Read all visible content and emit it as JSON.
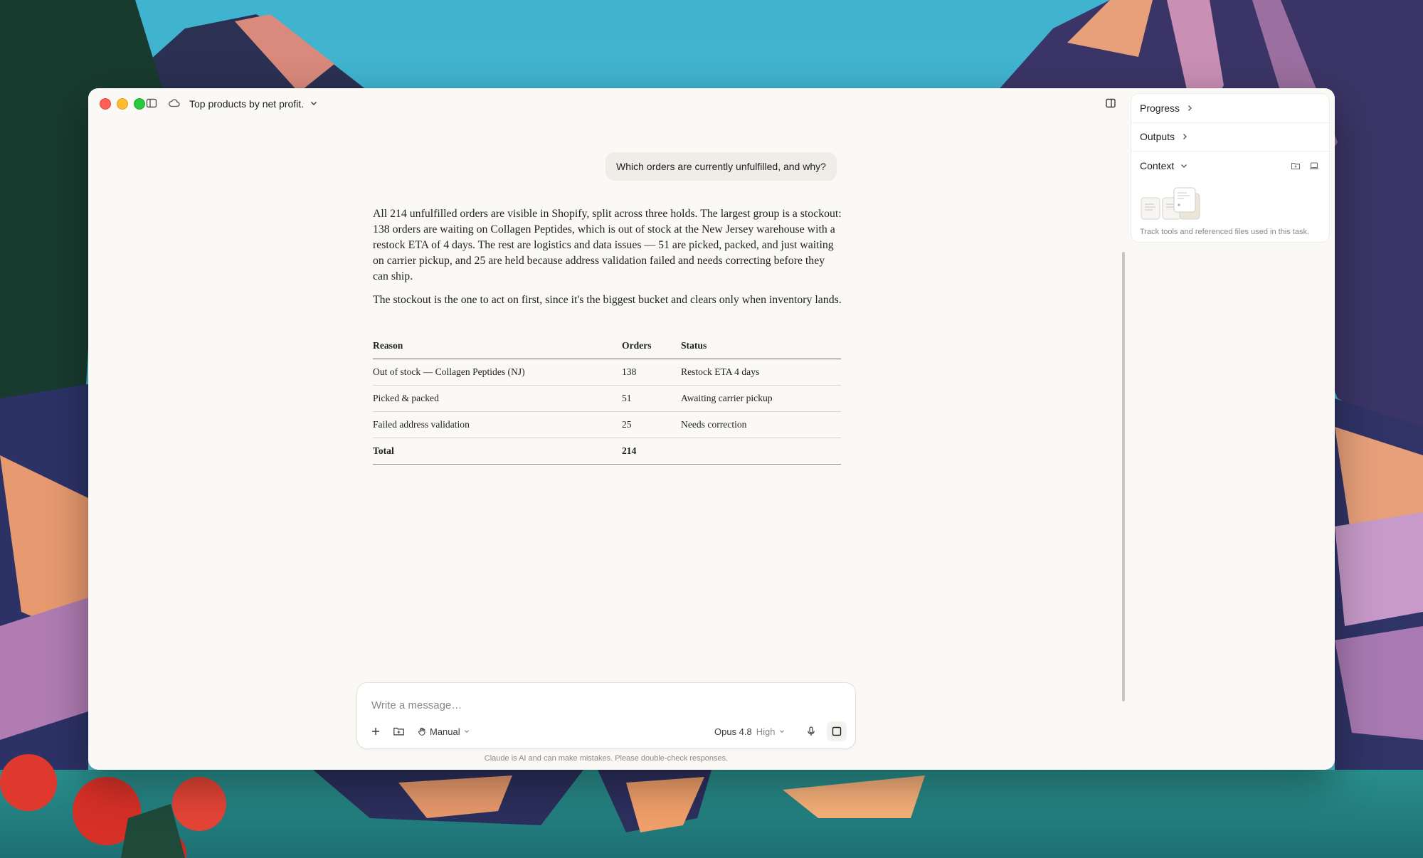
{
  "window": {
    "title": "Top products by net profit."
  },
  "chat": {
    "user_message": "Which orders are currently unfulfilled, and why?",
    "answer_paragraphs": [
      "All 214 unfulfilled orders are visible in Shopify, split across three holds. The largest group is a stockout: 138 orders are waiting on Collagen Peptides, which is out of stock at the New Jersey warehouse with a restock ETA of 4 days. The rest are logistics and data issues — 51 are picked, packed, and just waiting on carrier pickup, and 25 are held because address validation failed and needs correcting before they can ship.",
      "The stockout is the one to act on first, since it's the biggest bucket and clears only when inventory lands."
    ],
    "table": {
      "headers": [
        "Reason",
        "Orders",
        "Status"
      ],
      "rows": [
        [
          "Out of stock — Collagen Peptides (NJ)",
          "138",
          "Restock ETA 4 days"
        ],
        [
          "Picked & packed",
          "51",
          "Awaiting carrier pickup"
        ],
        [
          "Failed address validation",
          "25",
          "Needs correction"
        ]
      ],
      "total": [
        "Total",
        "214",
        ""
      ]
    }
  },
  "side_panel": {
    "progress_label": "Progress",
    "outputs_label": "Outputs",
    "context_label": "Context",
    "context_note": "Track tools and referenced files used in this task."
  },
  "composer": {
    "placeholder": "Write a message…",
    "mode_label": "Manual",
    "model_label": "Opus 4.8",
    "effort_label": "High",
    "disclaimer": "Claude is AI and can make mistakes. Please double-check responses."
  },
  "colors": {
    "window_bg": "#faf9f6",
    "user_bubble_bg": "#efede7",
    "traffic_red": "#ff5f57",
    "traffic_yellow": "#febc2e",
    "traffic_green": "#28c840"
  }
}
